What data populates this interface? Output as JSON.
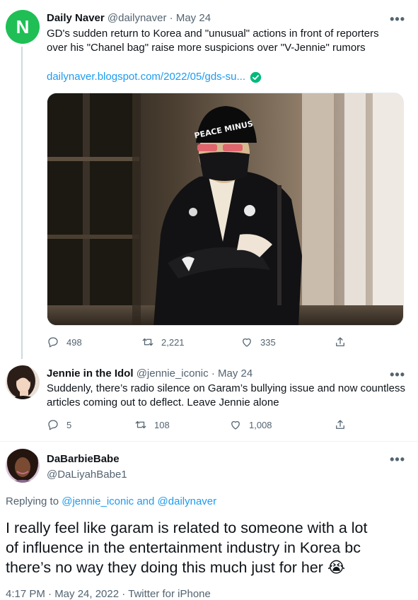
{
  "tweet1": {
    "avatar_letter": "N",
    "avatar_color": "#1fbf56",
    "name": "Daily Naver",
    "handle": "@dailynaver",
    "dot": "·",
    "date": "May 24",
    "more": "•••",
    "text_line1": "GD's sudden return to Korea and \"unusual\" actions in front of reporters",
    "text_line2": "over his \"Chanel bag\" raise more suspicions over \"V-Jennie\" rumors",
    "link": "dailynaver.blogspot.com/2022/05/gds-su...",
    "replies": "498",
    "retweets": "2,221",
    "likes": "335",
    "hat_text": "PEACE MINUS"
  },
  "tweet2": {
    "name": "Jennie in the Idol",
    "handle": "@jennie_iconic",
    "dot": "·",
    "date": "May 24",
    "more": "•••",
    "text_line1": "Suddenly, there’s radio silence on Garam’s bullying issue and now countless",
    "text_line2": "articles coming out to deflect. Leave Jennie alone",
    "replies": "5",
    "retweets": "108",
    "likes": "1,008"
  },
  "tweet3": {
    "name": "DaBarbieBabe",
    "handle": "@DaLiyahBabe1",
    "more": "•••",
    "replying_prefix": "Replying to ",
    "replying_user1": "@jennie_iconic",
    "replying_and": " and ",
    "replying_user2": "@dailynaver",
    "text_line1": "I really feel like garam is related to someone with a lot",
    "text_line2": "of influence in the entertainment industry in Korea bc",
    "text_line3": "there’s no way they doing this much just for her",
    "emoji": "😭",
    "timestamp": "4:17 PM · May 24, 2022 · Twitter for iPhone"
  },
  "colors": {
    "link": "#1d9bf0",
    "muted": "#536471",
    "verified": "#00ba7c",
    "thread": "#cfd9de"
  },
  "icons": [
    "reply-icon",
    "retweet-icon",
    "like-icon",
    "share-icon",
    "verified-check-icon",
    "more-icon"
  ]
}
